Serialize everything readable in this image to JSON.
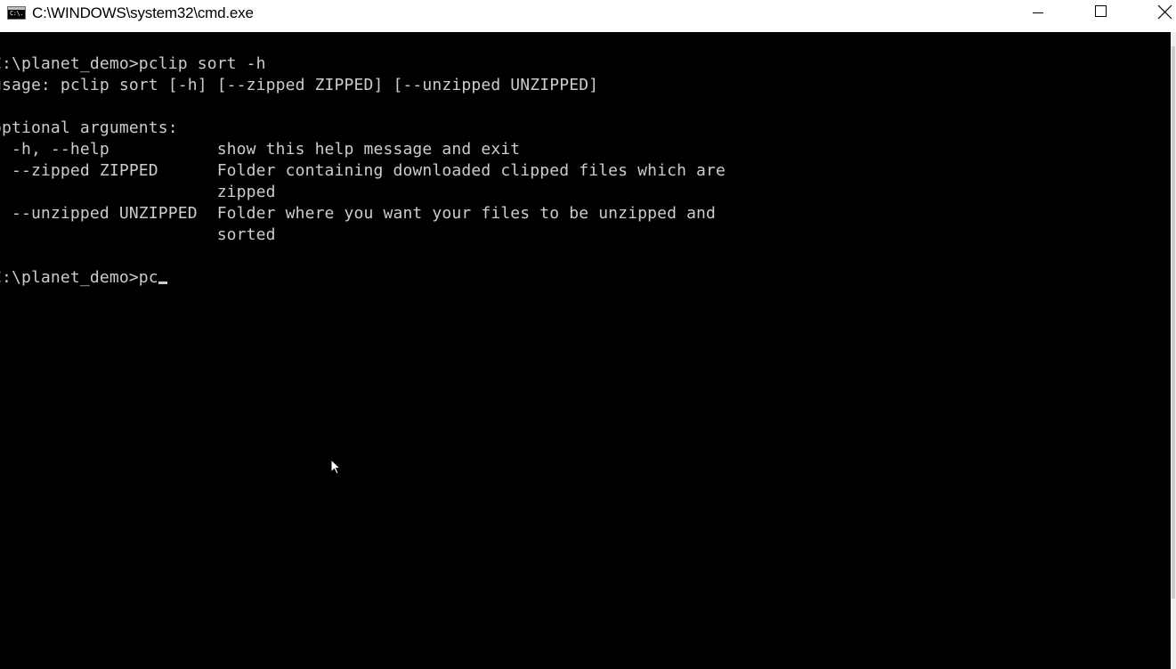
{
  "window": {
    "title": "C:\\WINDOWS\\system32\\cmd.exe",
    "icon": "cmd-icon",
    "icon_text": "C:\\."
  },
  "controls": {
    "minimize_icon": "minimize-icon",
    "maximize_icon": "maximize-icon",
    "close_icon": "close-icon"
  },
  "console": {
    "background": "#000000",
    "foreground": "#cccccc",
    "lines": [
      "C:\\planet_demo>pclip sort -h",
      "usage: pclip sort [-h] [--zipped ZIPPED] [--unzipped UNZIPPED]",
      "",
      "optional arguments:",
      "  -h, --help           show this help message and exit",
      "  --zipped ZIPPED      Folder containing downloaded clipped files which are",
      "                       zipped",
      "  --unzipped UNZIPPED  Folder where you want your files to be unzipped and",
      "                       sorted",
      "",
      "C:\\planet_demo>pc"
    ]
  }
}
